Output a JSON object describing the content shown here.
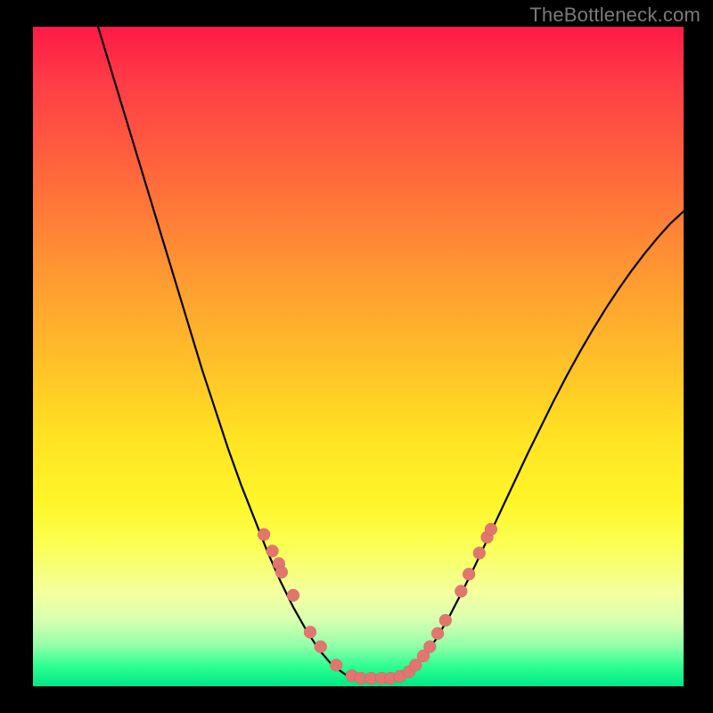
{
  "watermark": "TheBottleneck.com",
  "chart_data": {
    "type": "line",
    "title": "",
    "xlabel": "",
    "ylabel": "",
    "xlim": [
      0,
      100
    ],
    "ylim": [
      0,
      100
    ],
    "curve": [
      {
        "x": 10.0,
        "y": 100.0
      },
      {
        "x": 12.0,
        "y": 93.5
      },
      {
        "x": 14.0,
        "y": 87.0
      },
      {
        "x": 16.0,
        "y": 80.5
      },
      {
        "x": 18.0,
        "y": 74.0
      },
      {
        "x": 20.0,
        "y": 67.5
      },
      {
        "x": 22.0,
        "y": 61.0
      },
      {
        "x": 24.0,
        "y": 54.5
      },
      {
        "x": 26.0,
        "y": 48.0
      },
      {
        "x": 28.0,
        "y": 42.0
      },
      {
        "x": 30.0,
        "y": 36.0
      },
      {
        "x": 32.0,
        "y": 30.5
      },
      {
        "x": 34.0,
        "y": 25.5
      },
      {
        "x": 36.0,
        "y": 20.5
      },
      {
        "x": 38.0,
        "y": 16.0
      },
      {
        "x": 40.0,
        "y": 12.0
      },
      {
        "x": 42.0,
        "y": 8.5
      },
      {
        "x": 44.0,
        "y": 5.5
      },
      {
        "x": 46.0,
        "y": 3.2
      },
      {
        "x": 48.0,
        "y": 1.8
      },
      {
        "x": 50.0,
        "y": 1.2
      },
      {
        "x": 52.0,
        "y": 1.2
      },
      {
        "x": 54.0,
        "y": 1.2
      },
      {
        "x": 56.0,
        "y": 1.4
      },
      {
        "x": 58.0,
        "y": 2.4
      },
      {
        "x": 60.0,
        "y": 4.4
      },
      {
        "x": 62.0,
        "y": 7.2
      },
      {
        "x": 64.0,
        "y": 10.6
      },
      {
        "x": 66.0,
        "y": 14.4
      },
      {
        "x": 68.0,
        "y": 18.4
      },
      {
        "x": 70.0,
        "y": 22.6
      },
      {
        "x": 72.0,
        "y": 26.8
      },
      {
        "x": 74.0,
        "y": 31.0
      },
      {
        "x": 76.0,
        "y": 35.2
      },
      {
        "x": 78.0,
        "y": 39.2
      },
      {
        "x": 80.0,
        "y": 43.2
      },
      {
        "x": 82.0,
        "y": 47.0
      },
      {
        "x": 84.0,
        "y": 50.6
      },
      {
        "x": 86.0,
        "y": 54.0
      },
      {
        "x": 88.0,
        "y": 57.2
      },
      {
        "x": 90.0,
        "y": 60.2
      },
      {
        "x": 92.0,
        "y": 63.0
      },
      {
        "x": 94.0,
        "y": 65.6
      },
      {
        "x": 96.0,
        "y": 68.0
      },
      {
        "x": 98.0,
        "y": 70.2
      },
      {
        "x": 100.0,
        "y": 72.0
      }
    ],
    "markers": [
      {
        "x": 35.5,
        "y": 23.0
      },
      {
        "x": 36.8,
        "y": 20.5
      },
      {
        "x": 37.8,
        "y": 18.6
      },
      {
        "x": 38.2,
        "y": 17.3
      },
      {
        "x": 40.0,
        "y": 13.8
      },
      {
        "x": 42.6,
        "y": 8.2
      },
      {
        "x": 44.2,
        "y": 6.0
      },
      {
        "x": 46.6,
        "y": 3.2
      },
      {
        "x": 49.0,
        "y": 1.6
      },
      {
        "x": 50.4,
        "y": 1.2
      },
      {
        "x": 52.0,
        "y": 1.2
      },
      {
        "x": 53.6,
        "y": 1.2
      },
      {
        "x": 55.0,
        "y": 1.2
      },
      {
        "x": 56.4,
        "y": 1.5
      },
      {
        "x": 57.8,
        "y": 2.2
      },
      {
        "x": 58.8,
        "y": 3.2
      },
      {
        "x": 60.0,
        "y": 4.6
      },
      {
        "x": 61.0,
        "y": 6.0
      },
      {
        "x": 62.2,
        "y": 8.0
      },
      {
        "x": 63.4,
        "y": 10.0
      },
      {
        "x": 65.8,
        "y": 14.4
      },
      {
        "x": 67.0,
        "y": 17.0
      },
      {
        "x": 68.6,
        "y": 20.2
      },
      {
        "x": 69.8,
        "y": 22.6
      },
      {
        "x": 70.4,
        "y": 23.8
      }
    ],
    "gradient_stops": [
      {
        "pos": 0,
        "color": "#ff1a46"
      },
      {
        "pos": 8,
        "color": "#ff3b46"
      },
      {
        "pos": 18,
        "color": "#ff5a3f"
      },
      {
        "pos": 28,
        "color": "#ff7a38"
      },
      {
        "pos": 40,
        "color": "#ffa030"
      },
      {
        "pos": 52,
        "color": "#ffc328"
      },
      {
        "pos": 62,
        "color": "#ffe223"
      },
      {
        "pos": 72,
        "color": "#fff52a"
      },
      {
        "pos": 78,
        "color": "#fbff4e"
      },
      {
        "pos": 86,
        "color": "#f3ffa0"
      },
      {
        "pos": 90,
        "color": "#d8ffb0"
      },
      {
        "pos": 94,
        "color": "#8effa8"
      },
      {
        "pos": 97,
        "color": "#2dff90"
      },
      {
        "pos": 100,
        "color": "#00e887"
      }
    ]
  }
}
